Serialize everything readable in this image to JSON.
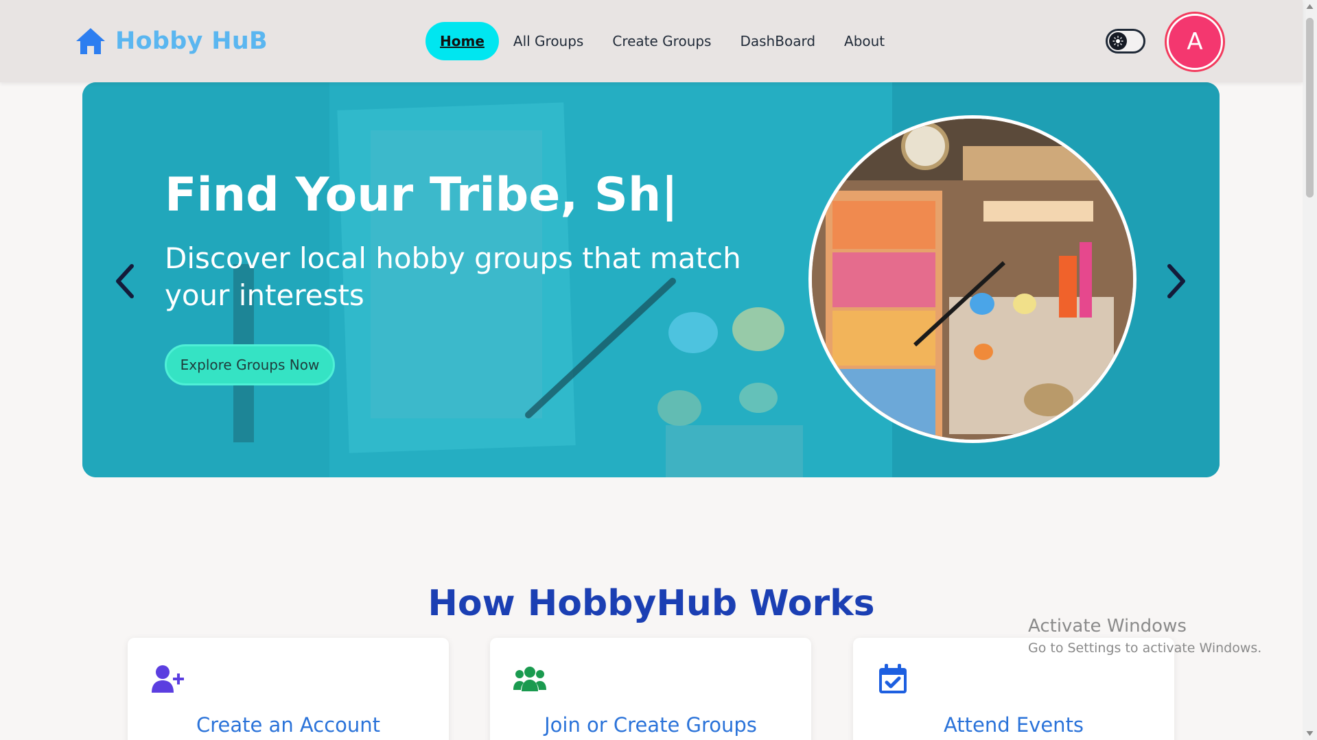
{
  "brand": {
    "name": "Hobby HuB"
  },
  "nav": {
    "links": [
      {
        "label": "Home"
      },
      {
        "label": "All Groups"
      },
      {
        "label": "Create Groups"
      },
      {
        "label": "DashBoard"
      },
      {
        "label": "About"
      }
    ],
    "active_index": 0
  },
  "user": {
    "avatar_initial": "A"
  },
  "hero": {
    "title": "Find Your Tribe, Sh|",
    "subtitle": "Discover local hobby groups that match your interests",
    "cta_label": "Explore Groups Now"
  },
  "how_it_works": {
    "title": "How HobbyHub Works",
    "cards": [
      {
        "title": "Create an Account",
        "icon": "user-plus-icon",
        "icon_color": "#5b3ee0"
      },
      {
        "title": "Join or Create Groups",
        "icon": "users-icon",
        "icon_color": "#1a9a4f"
      },
      {
        "title": "Attend Events",
        "icon": "calendar-check-icon",
        "icon_color": "#1d5fe0"
      }
    ]
  },
  "watermark": {
    "title": "Activate Windows",
    "subtitle": "Go to Settings to activate Windows."
  },
  "colors": {
    "brand": "#5ab6f0",
    "active_nav": "#00e6f0",
    "hero_overlay": "#27b3c6",
    "cta": "#35e3c4",
    "avatar": "#f4376f",
    "heading": "#1b3fb3",
    "card_title": "#2b73d9"
  }
}
